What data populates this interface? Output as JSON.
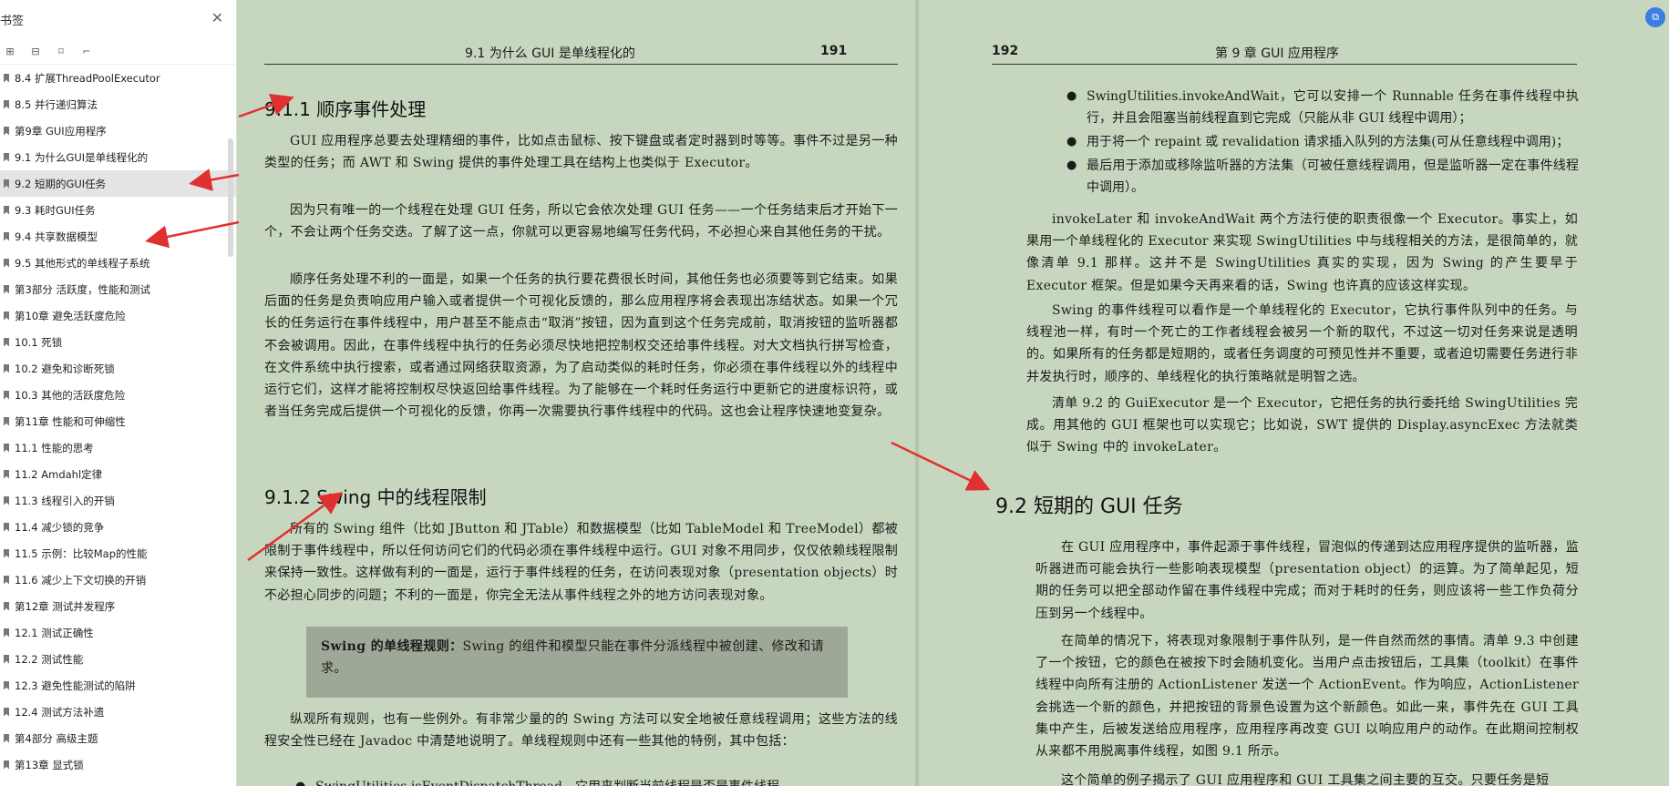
{
  "sidebar": {
    "title": "书签",
    "items": [
      {
        "label": "8.4  扩展ThreadPoolExecutor"
      },
      {
        "label": "8.5  并行递归算法"
      },
      {
        "label": "第9章  GUI应用程序"
      },
      {
        "label": "9.1  为什么GUI是单线程化的"
      },
      {
        "label": "9.2  短期的GUI任务"
      },
      {
        "label": "9.3  耗时GUI任务"
      },
      {
        "label": "9.4  共享数据模型"
      },
      {
        "label": "9.5  其他形式的单线程子系统"
      },
      {
        "label": "第3部分  活跃度，性能和测试"
      },
      {
        "label": "第10章  避免活跃度危险"
      },
      {
        "label": "10.1  死锁"
      },
      {
        "label": "10.2  避免和诊断死锁"
      },
      {
        "label": "10.3  其他的活跃度危险"
      },
      {
        "label": "第11章  性能和可伸缩性"
      },
      {
        "label": "11.1  性能的思考"
      },
      {
        "label": "11.2  Amdahl定律"
      },
      {
        "label": "11.3  线程引入的开销"
      },
      {
        "label": "11.4  减少锁的竞争"
      },
      {
        "label": "11.5  示例：比较Map的性能"
      },
      {
        "label": "11.6  减少上下文切换的开销"
      },
      {
        "label": "第12章  测试并发程序"
      },
      {
        "label": "12.1  测试正确性"
      },
      {
        "label": "12.2  测试性能"
      },
      {
        "label": "12.3  避免性能测试的陷阱"
      },
      {
        "label": "12.4  测试方法补遗"
      },
      {
        "label": "第4部分  高级主题"
      },
      {
        "label": "第13章  显式锁"
      }
    ]
  },
  "left_page": {
    "header_title": "9.1   为什么 GUI 是单线程化的",
    "page_number": "191",
    "section_911": "9.1.1   顺序事件处理",
    "p1": "GUI 应用程序总要去处理精细的事件，比如点击鼠标、按下键盘或者定时器到时等等。事件不过是另一种类型的任务；而 AWT 和 Swing 提供的事件处理工具在结构上也类似于 Executor。",
    "p2": "因为只有唯一的一个线程在处理 GUI 任务，所以它会依次处理 GUI 任务——一个任务结束后才开始下一个，不会让两个任务交迭。了解了这一点，你就可以更容易地编写任务代码，不必担心来自其他任务的干扰。",
    "p3": "顺序任务处理不利的一面是，如果一个任务的执行要花费很长时间，其他任务也必须要等到它结束。如果后面的任务是负责响应用户输入或者提供一个可视化反馈的，那么应用程序将会表现出冻结状态。如果一个冗长的任务运行在事件线程中，用户甚至不能点击“取消”按钮，因为直到这个任务完成前，取消按钮的监听器都不会被调用。因此，在事件线程中执行的任务必须尽快地把控制权交还给事件线程。对大文档执行拼写检查，在文件系统中执行搜索，或者通过网络获取资源，为了启动类似的耗时任务，你必须在事件线程以外的线程中运行它们，这样才能将控制权尽快返回给事件线程。为了能够在一个耗时任务运行中更新它的进度标识符，或者当任务完成后提供一个可视化的反馈，你再一次需要执行事件线程中的代码。这也会让程序快速地变复杂。",
    "section_912": "9.1.2   Swing 中的线程限制",
    "p4": "所有的 Swing 组件（比如 JButton 和 JTable）和数据模型（比如 TableModel 和 TreeModel）都被限制于事件线程中，所以任何访问它们的代码必须在事件线程中运行。GUI 对象不用同步，仅仅依赖线程限制来保持一致性。这样做有利的一面是，运行于事件线程的任务，在访问表现对象（presentation objects）时不必担心同步的问题；不利的一面是，你完全无法从事件线程之外的地方访问表现对象。",
    "rule_label": "Swing 的单线程规则：",
    "rule_text": "Swing 的组件和模型只能在事件分派线程中被创建、修改和请求。",
    "p5": "纵观所有规则，也有一些例外。有非常少量的的 Swing 方法可以安全地被任意线程调用；这些方法的线程安全性已经在 Javadoc 中清楚地说明了。单线程规则中还有一些其他的特例，其中包括：",
    "bullet_partial": "SwingUtilities.isEventDispatchThread，它用来判断当前线程是否是事件线程。"
  },
  "right_page": {
    "page_number": "192",
    "header_title": "第 9 章   GUI 应用程序",
    "bullets": [
      "SwingUtilities.invokeAndWait，它可以安排一个 Runnable 任务在事件线程中执行，并且会阻塞当前线程直到它完成（只能从非 GUI 线程中调用）；",
      "用于将一个 repaint 或 revalidation 请求插入队列的方法集(可从任意线程中调用)；",
      "最后用于添加或移除监听器的方法集（可被任意线程调用，但是监听器一定在事件线程中调用）。"
    ],
    "p1": "invokeLater 和 invokeAndWait 两个方法行使的职责很像一个 Executor。事实上，如果用一个单线程化的 Executor 来实现 SwingUtilities 中与线程相关的方法，是很简单的，就像清单 9.1 那样。这并不是 SwingUtilities 真实的实现，因为 Swing 的产生要早于 Executor 框架。但是如果今天再来看的话，Swing 也许真的应该这样实现。",
    "p2": "Swing 的事件线程可以看作是一个单线程化的 Executor，它执行事件队列中的任务。与线程池一样，有时一个死亡的工作者线程会被另一个新的取代，不过这一切对任务来说是透明的。如果所有的任务都是短期的，或者任务调度的可预见性并不重要，或者迫切需要任务进行非并发执行时，顺序的、单线程化的执行策略就是明智之选。",
    "p3": "清单 9.2 的 GuiExecutor 是一个 Executor，它把任务的执行委托给 SwingUtilities 完成。用其他的 GUI 框架也可以实现它；比如说，SWT 提供的 Display.asyncExec 方法就类似于 Swing 中的 invokeLater。",
    "section_92": "9.2   短期的 GUI 任务",
    "p4": "在 GUI 应用程序中，事件起源于事件线程，冒泡似的传递到达应用程序提供的监听器，监听器进而可能会执行一些影响表现模型（presentation object）的运算。为了简单起见，短期的任务可以把全部动作留在事件线程中完成；而对于耗时的任务，则应该将一些工作负荷分压到另一个线程中。",
    "p5": "在简单的情况下，将表现对象限制于事件队列，是一件自然而然的事情。清单 9.3 中创建了一个按钮，它的颜色在被按下时会随机变化。当用户点击按钮后，工具集（toolkit）在事件线程中向所有注册的 ActionListener 发送一个 ActionEvent。作为响应，ActionListener 会挑选一个新的颜色，并把按钮的背景色设置为这个新颜色。如此一来，事件先在 GUI 工具集中产生，后被发送给应用程序，应用程序再改变 GUI 以响应用户的动作。在此期间控制权从来都不用脱离事件线程，如图 9.1 所示。",
    "p6": "这个简单的例子揭示了 GUI 应用程序和 GUI 工具集之间主要的互交。只要任务是短"
  },
  "colors": {
    "page_bg": "#c7d7bf",
    "arrow": "#e03030",
    "active_item": "#e4e4e4"
  }
}
